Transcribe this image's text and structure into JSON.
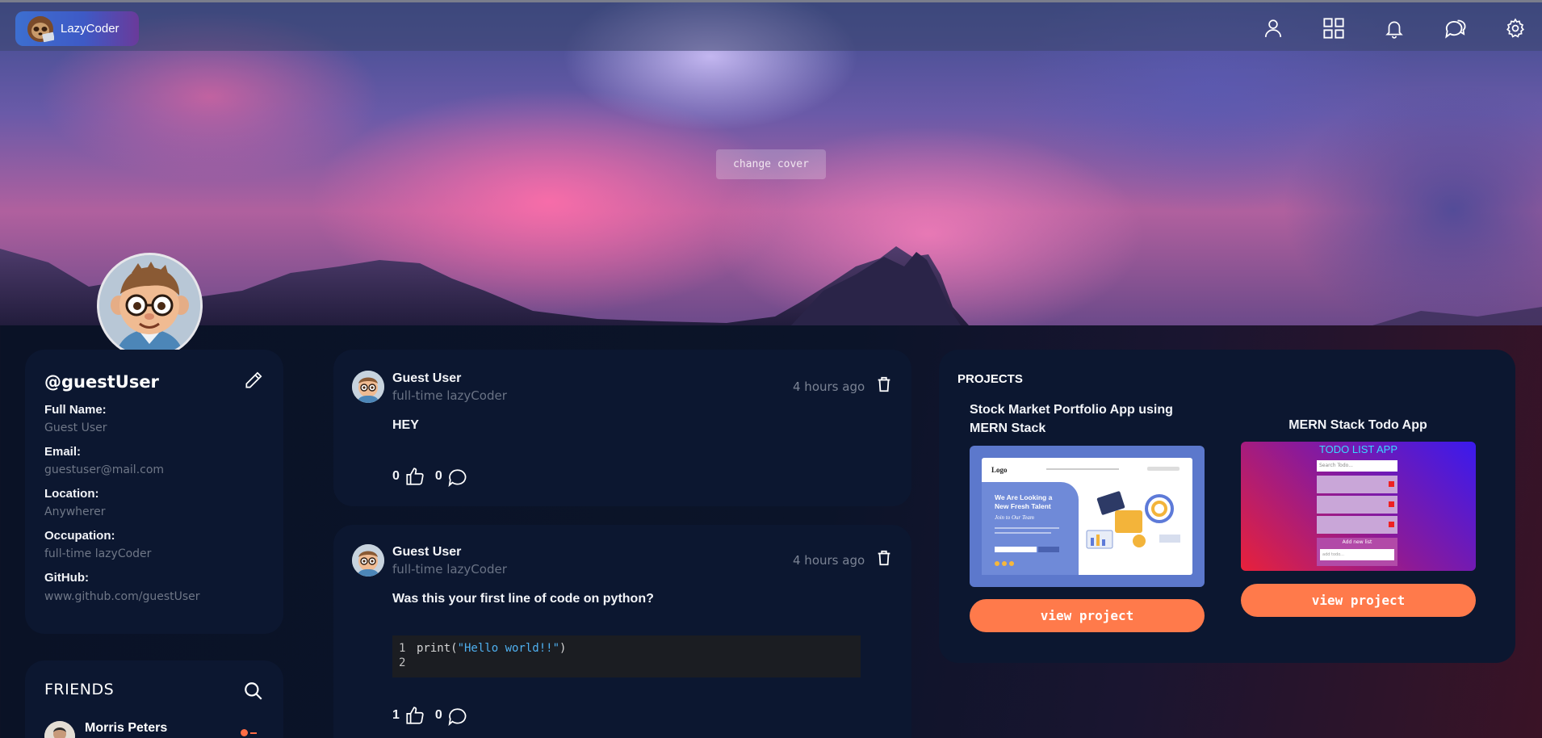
{
  "brand": {
    "name": "LazyCoder"
  },
  "nav": {
    "icons": [
      "user-icon",
      "grid-icon",
      "bell-icon",
      "chat-icon",
      "settings-icon"
    ]
  },
  "cover": {
    "change_label": "change cover"
  },
  "profile": {
    "username": "@guestUser",
    "fields": [
      {
        "label": "Full Name:",
        "value": "Guest User"
      },
      {
        "label": "Email:",
        "value": "guestuser@mail.com"
      },
      {
        "label": "Location:",
        "value": "Anywherer"
      },
      {
        "label": "Occupation:",
        "value": "full-time lazyCoder"
      },
      {
        "label": "GitHub:",
        "value": "www.github.com/guestUser"
      }
    ]
  },
  "friends": {
    "title": "FRIENDS",
    "items": [
      {
        "name": "Morris Peters"
      }
    ]
  },
  "posts": [
    {
      "author": "Guest User",
      "subtitle": "full-time lazyCoder",
      "time": "4 hours ago",
      "text": "HEY",
      "likes": "0",
      "comments": "0"
    },
    {
      "author": "Guest User",
      "subtitle": "full-time lazyCoder",
      "time": "4 hours ago",
      "text": "Was this your first line of code on python?",
      "code": {
        "line1_num": "1",
        "line1_fn": "print(",
        "line1_str": "\"Hello world!!\"",
        "line1_end": ")",
        "line2_num": "2"
      },
      "likes": "1",
      "comments": "0"
    }
  ],
  "projects": {
    "title": "PROJECTS",
    "items": [
      {
        "title": "Stock Market Portfolio App using MERN Stack",
        "button": "view project",
        "preview": {
          "logo": "Logo",
          "headline1": "We Are Looking a",
          "headline2": "New Fresh Talent",
          "tagline": "Join to Our Team"
        }
      },
      {
        "title": "MERN Stack Todo App",
        "button": "view project",
        "preview": {
          "heading": "TODO LIST APP",
          "search": "Search Todo...",
          "add": "Add new list",
          "input": "add todo..."
        }
      }
    ]
  },
  "colors": {
    "accent": "#ff7a4b",
    "card": "#0c1730",
    "muted": "#6f7787"
  }
}
